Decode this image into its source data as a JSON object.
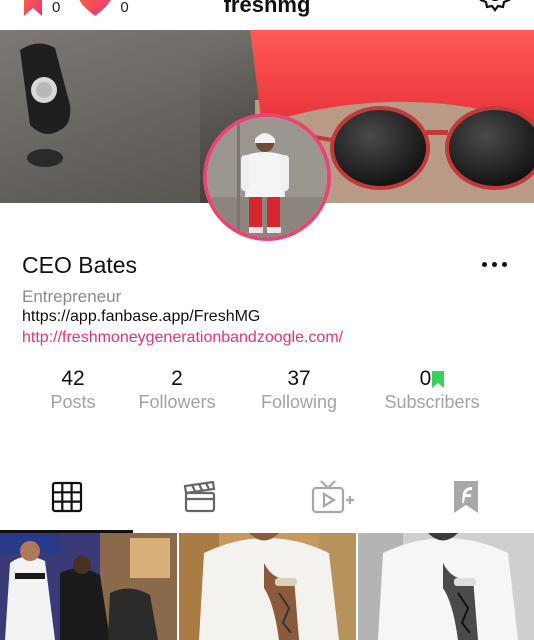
{
  "header": {
    "title": "freshmg",
    "bookmark_count": "0",
    "likes_count": "0"
  },
  "profile": {
    "name": "CEO Bates",
    "role": "Entrepreneur",
    "link_primary": "https://app.fanbase.app/FreshMG",
    "link_secondary": "http://freshmoneygenerationbandzoogle.com/"
  },
  "stats": [
    {
      "value": "42",
      "label": "Posts"
    },
    {
      "value": "2",
      "label": "Followers"
    },
    {
      "value": "37",
      "label": "Following"
    },
    {
      "value": "0",
      "label": "Subscribers"
    }
  ],
  "tabs": [
    "grid-icon",
    "clapperboard-icon",
    "tv-plus-icon",
    "fanbase-flag-icon"
  ],
  "colors": {
    "accent_pink": "#e84574",
    "link_pink": "#e8317a",
    "subscriber_green": "#3ad15a",
    "muted_gray": "#a2a2a6"
  }
}
